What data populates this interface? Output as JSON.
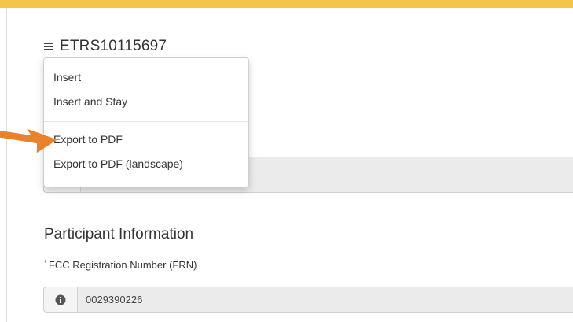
{
  "colors": {
    "top_bar": "#f3c54a",
    "arrow": "#e9822b",
    "field_bg": "#ebebeb"
  },
  "header": {
    "menu_icon": "hamburger-icon",
    "record_id": "ETRS10115697"
  },
  "menu": {
    "items_group_1": [
      {
        "label": "Insert"
      },
      {
        "label": "Insert and Stay"
      }
    ],
    "items_group_2": [
      {
        "label": "Export to PDF"
      },
      {
        "label": "Export to PDF (landscape)"
      }
    ]
  },
  "participant": {
    "section_title": "Participant Information",
    "frn_required_mark": "*",
    "frn_label": "FCC Registration Number (FRN)",
    "frn_icon": "info-icon",
    "frn_value": "0029390226"
  }
}
